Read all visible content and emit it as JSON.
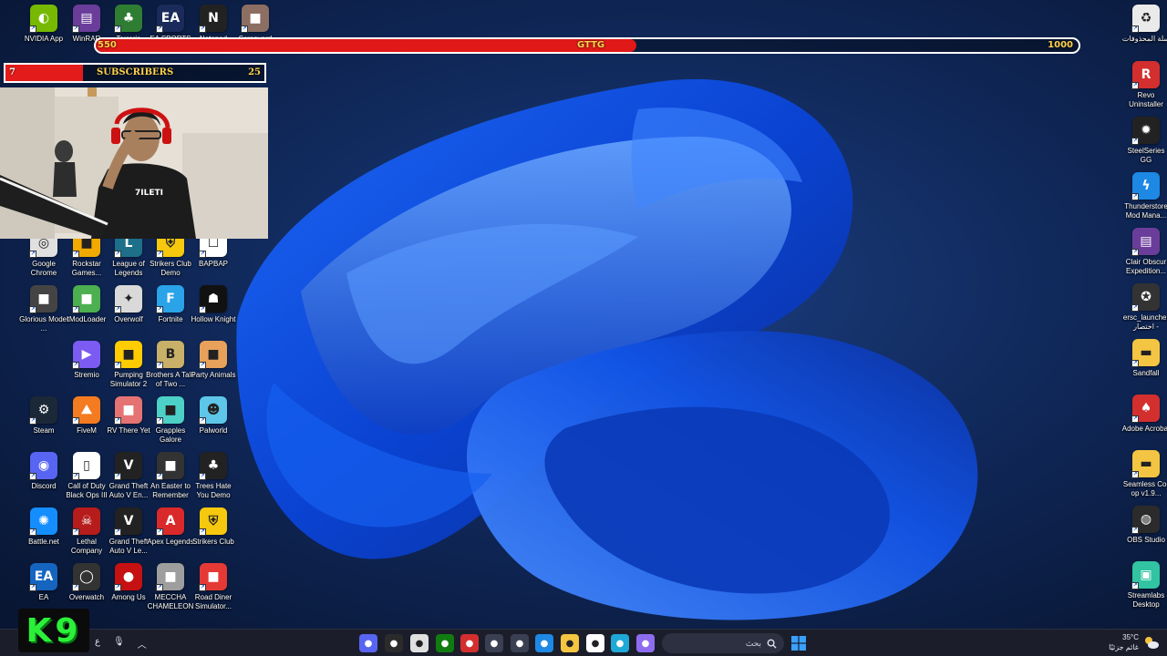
{
  "subscriber_goal_bar": {
    "start": "550",
    "name": "GTTG",
    "end": "1000",
    "progress": 0.55
  },
  "subscriber_widget": {
    "current": "7",
    "label": "SUBSCRIBERS",
    "target": "25",
    "progress": 0.3
  },
  "left_icons": [
    {
      "label": "NVIDIA App",
      "icon": "nvidia-icon",
      "color": "#76b900"
    },
    {
      "label": "WinRAR",
      "icon": "winrar-icon",
      "color": "#6a3d9a"
    },
    {
      "label": "Terraria",
      "icon": "terraria-icon",
      "color": "#2e7d32"
    },
    {
      "label": "EA SPORTS",
      "icon": "ea-sports-icon",
      "color": "#1a2a5a"
    },
    {
      "label": "Notepad",
      "icon": "notepad-icon",
      "color": "#222222"
    },
    {
      "label": "Scrapyard",
      "icon": "scrapyard-icon",
      "color": "#8d6e63"
    },
    {
      "label": "Google Chrome",
      "icon": "chrome-icon",
      "color": "#e0e0e0"
    },
    {
      "label": "Rockstar Games...",
      "icon": "rockstar-icon",
      "color": "#f2a900"
    },
    {
      "label": "League of Legends",
      "icon": "league-icon",
      "color": "#1d6f8a"
    },
    {
      "label": "Strikers Club Demo",
      "icon": "strikers-demo-icon",
      "color": "#f6c90e"
    },
    {
      "label": "BAPBAP",
      "icon": "bapbap-icon",
      "color": "#ffffff"
    },
    {
      "label": "Glorious Model ...",
      "icon": "glorious-icon",
      "color": "#444444"
    },
    {
      "label": "tModLoader",
      "icon": "tmodloader-icon",
      "color": "#4caf50"
    },
    {
      "label": "Overwolf",
      "icon": "overwolf-icon",
      "color": "#d9d9d9"
    },
    {
      "label": "Fortnite",
      "icon": "fortnite-icon",
      "color": "#2aa3e8"
    },
    {
      "label": "Hollow Knight",
      "icon": "hollow-knight-icon",
      "color": "#111111"
    },
    {
      "label": "Stremio",
      "icon": "stremio-icon",
      "color": "#7b5bf2"
    },
    {
      "label": "Pumping Simulator 2",
      "icon": "pumping-icon",
      "color": "#ffcc00"
    },
    {
      "label": "Brothers A Tale of Two ...",
      "icon": "brothers-icon",
      "color": "#c8b068"
    },
    {
      "label": "Party Animals",
      "icon": "party-animals-icon",
      "color": "#e8a15a"
    },
    {
      "label": "Steam",
      "icon": "steam-icon",
      "color": "#1b2838"
    },
    {
      "label": "FiveM",
      "icon": "fivem-icon",
      "color": "#f47b20"
    },
    {
      "label": "RV There Yet",
      "icon": "rv-icon",
      "color": "#e57373"
    },
    {
      "label": "Grapples Galore",
      "icon": "grapples-icon",
      "color": "#4dd0c6"
    },
    {
      "label": "Palworld",
      "icon": "palworld-icon",
      "color": "#5ec6e8"
    },
    {
      "label": "Discord",
      "icon": "discord-icon",
      "color": "#5865f2"
    },
    {
      "label": "Call of Duty Black Ops III",
      "icon": "file-icon",
      "color": "#ffffff"
    },
    {
      "label": "Grand Theft Auto V En...",
      "icon": "gta-icon",
      "color": "#222222"
    },
    {
      "label": "An Easter to Remember",
      "icon": "easter-icon",
      "color": "#333333"
    },
    {
      "label": "Trees Hate You Demo",
      "icon": "trees-icon",
      "color": "#222222"
    },
    {
      "label": "Battle.net",
      "icon": "battlenet-icon",
      "color": "#148eff"
    },
    {
      "label": "Lethal Company",
      "icon": "lethal-icon",
      "color": "#b71c1c"
    },
    {
      "label": "Grand Theft Auto V Le...",
      "icon": "gta-legacy-icon",
      "color": "#222222"
    },
    {
      "label": "Apex Legends",
      "icon": "apex-icon",
      "color": "#da292a"
    },
    {
      "label": "Strikers Club",
      "icon": "strikers-icon",
      "color": "#f6c90e"
    },
    {
      "label": "EA",
      "icon": "ea-icon",
      "color": "#1565c0"
    },
    {
      "label": "Overwatch",
      "icon": "overwatch-icon",
      "color": "#333333"
    },
    {
      "label": "Among Us",
      "icon": "among-us-icon",
      "color": "#c51111"
    },
    {
      "label": "MECCHA CHAMELEON",
      "icon": "meccha-icon",
      "color": "#9e9e9e"
    },
    {
      "label": "Road Diner Simulator...",
      "icon": "road-diner-icon",
      "color": "#e53935"
    }
  ],
  "right_icons": [
    {
      "label": "سلة المحذوفات",
      "icon": "recycle-bin-icon",
      "color": "#eaeaea"
    },
    {
      "label": "Revo Uninstaller",
      "icon": "revo-icon",
      "color": "#d32f2f"
    },
    {
      "label": "SteelSeries GG",
      "icon": "steelseries-icon",
      "color": "#222222"
    },
    {
      "label": "Thunderstore Mod Mana...",
      "icon": "thunderstore-icon",
      "color": "#1e88e5"
    },
    {
      "label": "Clair Obscur Expedition...",
      "icon": "winrar-archive-icon",
      "color": "#6a3d9a"
    },
    {
      "label": "ersc_launcher اختصار -",
      "icon": "ersc-icon",
      "color": "#333333"
    },
    {
      "label": "Sandfall",
      "icon": "folder-icon",
      "color": "#f4c542"
    },
    {
      "label": "Adobe Acrobat",
      "icon": "acrobat-icon",
      "color": "#d32f2f"
    },
    {
      "label": "Seamless Co-op v1.9...",
      "icon": "folder-zip-icon",
      "color": "#f4c542"
    },
    {
      "label": "OBS Studio",
      "icon": "obs-icon",
      "color": "#2b2b2b"
    },
    {
      "label": "Streamlabs Desktop",
      "icon": "streamlabs-icon",
      "color": "#31c3a2"
    }
  ],
  "streamer_logo": "K9",
  "taskbar": {
    "lang": "ع",
    "search_placeholder": "بحث",
    "apps": [
      {
        "icon": "discord-taskbar-icon",
        "color": "#5865f2"
      },
      {
        "icon": "obs-taskbar-icon",
        "color": "#2b2b2b"
      },
      {
        "icon": "chrome-taskbar-icon",
        "color": "#e0e0e0"
      },
      {
        "icon": "xbox-taskbar-icon",
        "color": "#107c10"
      },
      {
        "icon": "opera-taskbar-icon",
        "color": "#d32f2f"
      },
      {
        "icon": "task-view-icon",
        "color": "#3a3f52"
      },
      {
        "icon": "settings-taskbar-icon",
        "color": "#3a3f52"
      },
      {
        "icon": "mail-taskbar-icon",
        "color": "#1e88e5"
      },
      {
        "icon": "file-explorer-icon",
        "color": "#f4c542"
      },
      {
        "icon": "google-taskbar-icon",
        "color": "#ffffff"
      },
      {
        "icon": "edge-taskbar-icon",
        "color": "#1fa9d6"
      },
      {
        "icon": "copilot-taskbar-icon",
        "color": "#8e6cf0"
      }
    ],
    "weather_temp": "35°C",
    "weather_desc": "غائم جزئيًا"
  }
}
